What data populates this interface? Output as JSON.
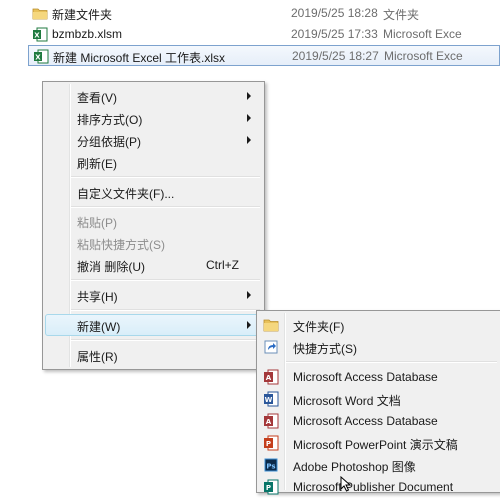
{
  "files": [
    {
      "name": "新建文件夹",
      "date": "2019/5/25 18:28",
      "type": "文件夹",
      "icon": "folder-icon"
    },
    {
      "name": "bzmbzb.xlsm",
      "date": "2019/5/25 17:33",
      "type": "Microsoft Exce",
      "icon": "excel-file-icon"
    },
    {
      "name": "新建 Microsoft Excel 工作表.xlsx",
      "date": "2019/5/25 18:27",
      "type": "Microsoft Exce",
      "icon": "excel-file-icon"
    }
  ],
  "context_menu": {
    "view": "查看(V)",
    "sort": "排序方式(O)",
    "group": "分组依据(P)",
    "refresh": "刷新(E)",
    "customize": "自定义文件夹(F)...",
    "paste": "粘贴(P)",
    "paste_shortcut": "粘贴快捷方式(S)",
    "undo_delete": "撤消 删除(U)",
    "undo_shortcut": "Ctrl+Z",
    "share": "共享(H)",
    "new": "新建(W)",
    "properties": "属性(R)"
  },
  "new_submenu": {
    "folder": "文件夹(F)",
    "shortcut": "快捷方式(S)",
    "items": [
      "Microsoft Access Database",
      "Microsoft Word 文档",
      "Microsoft Access Database",
      "Microsoft PowerPoint 演示文稿",
      "Adobe Photoshop 图像",
      "Microsoft Publisher Document"
    ]
  },
  "colors": {
    "menu_bg": "#f0f0f0",
    "hover_border": "#a8d8eb",
    "selection_border": "#7da2ce",
    "folder": "#e8c15a",
    "excel": "#1f7a3f",
    "access": "#a4373a",
    "word": "#2b579a",
    "powerpoint": "#c43e1c",
    "photoshop": "#0b2a4a",
    "publisher": "#077568"
  }
}
